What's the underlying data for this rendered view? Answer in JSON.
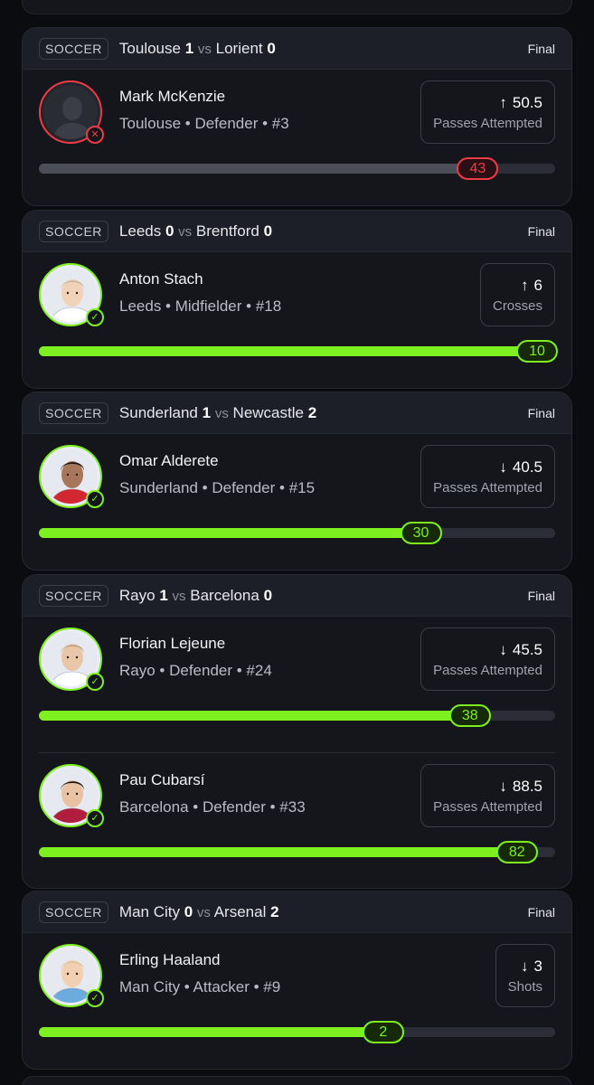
{
  "cards": [
    {
      "sport": "SOCCER",
      "home": "Toulouse",
      "home_score": "1",
      "vs": "vs",
      "away": "Lorient",
      "away_score": "0",
      "status": "Final",
      "players": [
        {
          "name": "Mark McKenzie",
          "meta": "Toulouse • Defender • #3",
          "arrow": "↑",
          "line": "50.5",
          "stat": "Passes Attempted",
          "result": "43",
          "progress": 0.85,
          "outcome": "lost",
          "mark_icon": "✕"
        }
      ]
    },
    {
      "sport": "SOCCER",
      "home": "Leeds",
      "home_score": "0",
      "vs": "vs",
      "away": "Brentford",
      "away_score": "0",
      "status": "Final",
      "players": [
        {
          "name": "Anton Stach",
          "meta": "Leeds • Midfielder • #18",
          "arrow": "↑",
          "line": "6",
          "stat": "Crosses",
          "result": "10",
          "progress": 1.0,
          "outcome": "won",
          "mark_icon": "✓"
        }
      ]
    },
    {
      "sport": "SOCCER",
      "home": "Sunderland",
      "home_score": "1",
      "vs": "vs",
      "away": "Newcastle",
      "away_score": "2",
      "status": "Final",
      "players": [
        {
          "name": "Omar Alderete",
          "meta": "Sunderland • Defender • #15",
          "arrow": "↓",
          "line": "40.5",
          "stat": "Passes Attempted",
          "result": "30",
          "progress": 0.74,
          "outcome": "won",
          "mark_icon": "✓"
        }
      ]
    },
    {
      "sport": "SOCCER",
      "home": "Rayo",
      "home_score": "1",
      "vs": "vs",
      "away": "Barcelona",
      "away_score": "0",
      "status": "Final",
      "players": [
        {
          "name": "Florian Lejeune",
          "meta": "Rayo • Defender • #24",
          "arrow": "↓",
          "line": "45.5",
          "stat": "Passes Attempted",
          "result": "38",
          "progress": 0.835,
          "outcome": "won",
          "mark_icon": "✓"
        },
        {
          "name": "Pau Cubarsí",
          "meta": "Barcelona • Defender • #33",
          "arrow": "↓",
          "line": "88.5",
          "stat": "Passes Attempted",
          "result": "82",
          "progress": 0.926,
          "outcome": "won",
          "mark_icon": "✓"
        }
      ]
    },
    {
      "sport": "SOCCER",
      "home": "Man City",
      "home_score": "0",
      "vs": "vs",
      "away": "Arsenal",
      "away_score": "2",
      "status": "Final",
      "players": [
        {
          "name": "Erling Haaland",
          "meta": "Man City • Attacker • #9",
          "arrow": "↓",
          "line": "3",
          "stat": "Shots",
          "result": "2",
          "progress": 0.667,
          "outcome": "won",
          "mark_icon": "✓"
        }
      ]
    }
  ],
  "colors": {
    "win": "#7ef01f",
    "loss": "#ef3b45",
    "card": "#14161c",
    "header": "#1c1f27"
  },
  "icons": {
    "avatar_placeholder": "person-silhouette-icon",
    "win_mark": "check-circle-icon",
    "loss_mark": "x-circle-icon",
    "over": "arrow-up-icon",
    "under": "arrow-down-icon"
  }
}
